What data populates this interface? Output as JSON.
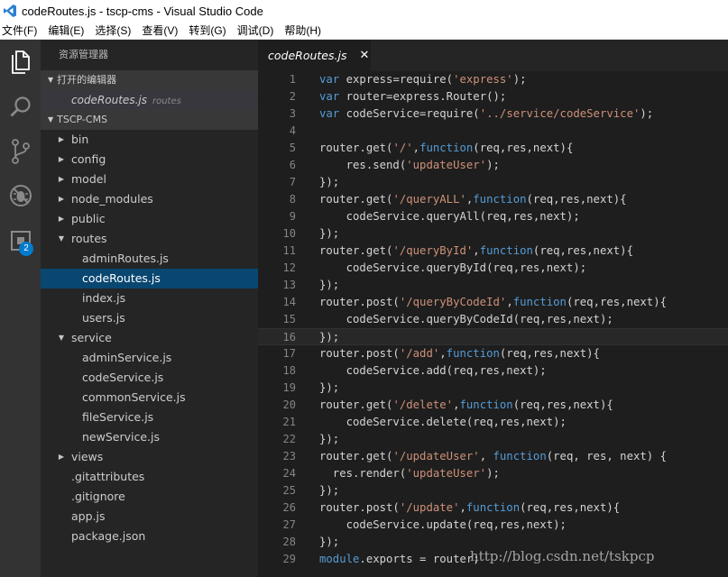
{
  "window": {
    "title": "codeRoutes.js - tscp-cms - Visual Studio Code"
  },
  "menu": [
    "文件(F)",
    "编辑(E)",
    "选择(S)",
    "查看(V)",
    "转到(G)",
    "调试(D)",
    "帮助(H)"
  ],
  "activity": {
    "icons": [
      "explorer-icon",
      "search-icon",
      "source-control-icon",
      "debug-icon",
      "extensions-icon"
    ],
    "extensions_badge": "2",
    "accent": "#007acc"
  },
  "sidebar": {
    "title": "资源管理器",
    "open_editors_header": "打开的编辑器",
    "open_editor": {
      "name": "codeRoutes.js",
      "desc": "routes"
    },
    "project_header": "TSCP-CMS",
    "tree": [
      {
        "label": "bin",
        "type": "folder-closed",
        "depth": 1
      },
      {
        "label": "config",
        "type": "folder-closed",
        "depth": 1
      },
      {
        "label": "model",
        "type": "folder-closed",
        "depth": 1
      },
      {
        "label": "node_modules",
        "type": "folder-closed",
        "depth": 1
      },
      {
        "label": "public",
        "type": "folder-closed",
        "depth": 1
      },
      {
        "label": "routes",
        "type": "folder-open",
        "depth": 1
      },
      {
        "label": "adminRoutes.js",
        "type": "file",
        "depth": 2
      },
      {
        "label": "codeRoutes.js",
        "type": "file",
        "depth": 2,
        "selected": true
      },
      {
        "label": "index.js",
        "type": "file",
        "depth": 2
      },
      {
        "label": "users.js",
        "type": "file",
        "depth": 2
      },
      {
        "label": "service",
        "type": "folder-open",
        "depth": 1
      },
      {
        "label": "adminService.js",
        "type": "file",
        "depth": 2
      },
      {
        "label": "codeService.js",
        "type": "file",
        "depth": 2
      },
      {
        "label": "commonService.js",
        "type": "file",
        "depth": 2
      },
      {
        "label": "fileService.js",
        "type": "file",
        "depth": 2
      },
      {
        "label": "newService.js",
        "type": "file",
        "depth": 2
      },
      {
        "label": "views",
        "type": "folder-closed",
        "depth": 1
      },
      {
        "label": ".gitattributes",
        "type": "file",
        "depth": 1
      },
      {
        "label": ".gitignore",
        "type": "file",
        "depth": 1
      },
      {
        "label": "app.js",
        "type": "file",
        "depth": 1
      },
      {
        "label": "package.json",
        "type": "file",
        "depth": 1
      }
    ]
  },
  "editor": {
    "tab_label": "codeRoutes.js",
    "tab_close": "✕",
    "current_line": 16,
    "lines": [
      [
        {
          "t": "var",
          "c": "kw"
        },
        {
          "t": " express=require("
        },
        {
          "t": "'express'",
          "c": "str"
        },
        {
          "t": ");"
        }
      ],
      [
        {
          "t": "var",
          "c": "kw"
        },
        {
          "t": " router=express.Router();"
        }
      ],
      [
        {
          "t": "var",
          "c": "kw"
        },
        {
          "t": " codeService=require("
        },
        {
          "t": "'../service/codeService'",
          "c": "str"
        },
        {
          "t": ");"
        }
      ],
      [],
      [
        {
          "t": "router.get("
        },
        {
          "t": "'/'",
          "c": "str"
        },
        {
          "t": ","
        },
        {
          "t": "function",
          "c": "kw"
        },
        {
          "t": "(req,res,next){"
        }
      ],
      [
        {
          "t": "    res.send("
        },
        {
          "t": "'updateUser'",
          "c": "str"
        },
        {
          "t": ");"
        }
      ],
      [
        {
          "t": "});"
        }
      ],
      [
        {
          "t": "router.get("
        },
        {
          "t": "'/queryALL'",
          "c": "str"
        },
        {
          "t": ","
        },
        {
          "t": "function",
          "c": "kw"
        },
        {
          "t": "(req,res,next){"
        }
      ],
      [
        {
          "t": "    codeService.queryAll(req,res,next);"
        }
      ],
      [
        {
          "t": "});"
        }
      ],
      [
        {
          "t": "router.get("
        },
        {
          "t": "'/queryById'",
          "c": "str"
        },
        {
          "t": ","
        },
        {
          "t": "function",
          "c": "kw"
        },
        {
          "t": "(req,res,next){"
        }
      ],
      [
        {
          "t": "    codeService.queryById(req,res,next);"
        }
      ],
      [
        {
          "t": "});"
        }
      ],
      [
        {
          "t": "router.post("
        },
        {
          "t": "'/queryByCodeId'",
          "c": "str"
        },
        {
          "t": ","
        },
        {
          "t": "function",
          "c": "kw"
        },
        {
          "t": "(req,res,next){"
        }
      ],
      [
        {
          "t": "    codeService.queryByCodeId(req,res,next);"
        }
      ],
      [
        {
          "t": "});"
        }
      ],
      [
        {
          "t": "router.post("
        },
        {
          "t": "'/add'",
          "c": "str"
        },
        {
          "t": ","
        },
        {
          "t": "function",
          "c": "kw"
        },
        {
          "t": "(req,res,next){"
        }
      ],
      [
        {
          "t": "    codeService.add(req,res,next);"
        }
      ],
      [
        {
          "t": "});"
        }
      ],
      [
        {
          "t": "router.get("
        },
        {
          "t": "'/delete'",
          "c": "str"
        },
        {
          "t": ","
        },
        {
          "t": "function",
          "c": "kw"
        },
        {
          "t": "(req,res,next){"
        }
      ],
      [
        {
          "t": "    codeService.delete(req,res,next);"
        }
      ],
      [
        {
          "t": "});"
        }
      ],
      [
        {
          "t": "router.get("
        },
        {
          "t": "'/updateUser'",
          "c": "str"
        },
        {
          "t": ", "
        },
        {
          "t": "function",
          "c": "kw"
        },
        {
          "t": "(req, res, next) {"
        }
      ],
      [
        {
          "t": "  res.render("
        },
        {
          "t": "'updateUser'",
          "c": "str"
        },
        {
          "t": ");"
        }
      ],
      [
        {
          "t": "});"
        }
      ],
      [
        {
          "t": "router.post("
        },
        {
          "t": "'/update'",
          "c": "str"
        },
        {
          "t": ","
        },
        {
          "t": "function",
          "c": "kw"
        },
        {
          "t": "(req,res,next){"
        }
      ],
      [
        {
          "t": "    codeService.update(req,res,next);"
        }
      ],
      [
        {
          "t": "});"
        }
      ],
      [
        {
          "t": "module",
          "c": "kw"
        },
        {
          "t": ".exports = router;"
        }
      ]
    ]
  },
  "watermark": "http://blog.csdn.net/tskpcp"
}
